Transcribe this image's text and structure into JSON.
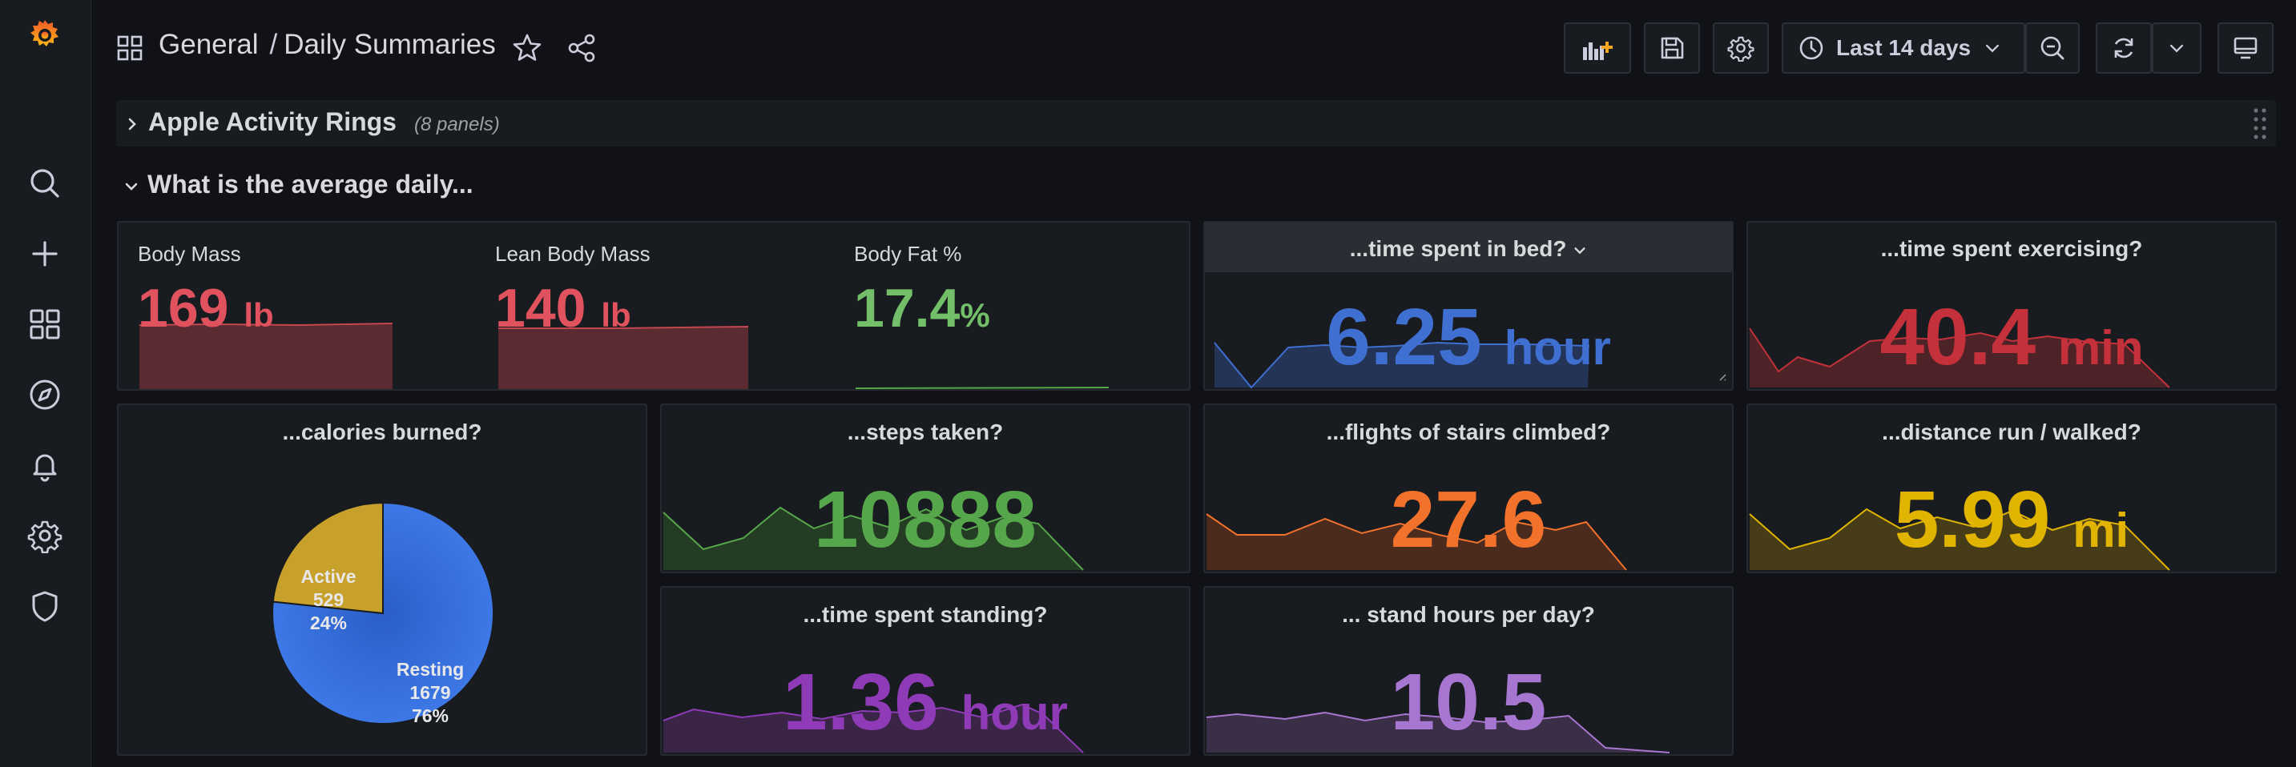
{
  "breadcrumb": {
    "folder": "General",
    "separator": "/",
    "dashboard": "Daily Summaries"
  },
  "toolbar": {
    "time_range": "Last 14 days"
  },
  "rows": {
    "collapsed": {
      "title": "Apple Activity Rings",
      "count": "(8 panels)"
    },
    "expanded": {
      "title": "What is the average daily..."
    }
  },
  "panels": {
    "body": {
      "items": [
        {
          "label": "Body Mass",
          "value": "169",
          "unit": "lb",
          "color": "#e0525e"
        },
        {
          "label": "Lean Body Mass",
          "value": "140",
          "unit": "lb",
          "color": "#e0525e"
        },
        {
          "label": "Body Fat %",
          "value": "17.4",
          "unit": "%",
          "color": "#73bf69"
        }
      ]
    },
    "bed": {
      "title": "...time spent in bed?",
      "value": "6.25",
      "unit": "hour",
      "color": "#3f6fd1"
    },
    "exercise": {
      "title": "...time spent exercising?",
      "value": "40.4",
      "unit": "min",
      "color": "#c4313b"
    },
    "calories": {
      "title": "...calories burned?",
      "slices": [
        {
          "name": "Active",
          "value": "529",
          "percent": "24%",
          "color": "#c7a12c"
        },
        {
          "name": "Resting",
          "value": "1679",
          "percent": "76%",
          "color": "#3872e0"
        }
      ]
    },
    "steps": {
      "title": "...steps taken?",
      "value": "10888",
      "unit": "",
      "color": "#56a64b"
    },
    "stairs": {
      "title": "...flights of stairs climbed?",
      "value": "27.6",
      "unit": "",
      "color": "#f2722c"
    },
    "distance": {
      "title": "...distance run / walked?",
      "value": "5.99",
      "unit": "mi",
      "color": "#e0b400"
    },
    "standing": {
      "title": "...time spent standing?",
      "value": "1.36",
      "unit": "hour",
      "color": "#8f3bb8"
    },
    "standhours": {
      "title": "... stand hours per day?",
      "value": "10.5",
      "unit": "",
      "color": "#a776d0"
    }
  },
  "icons": {
    "logo": "grafana-logo-icon",
    "search": "search-icon",
    "create": "plus-icon",
    "dashboards": "dashboards-grid-icon",
    "explore": "compass-icon",
    "alerting": "bell-icon",
    "configuration": "gear-icon",
    "admin": "shield-icon"
  }
}
